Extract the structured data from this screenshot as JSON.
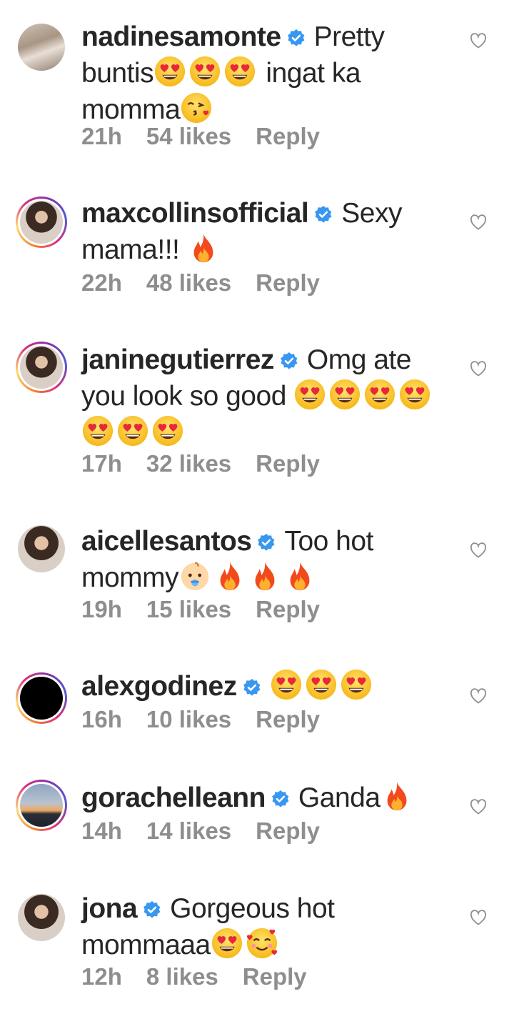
{
  "colors": {
    "username": "#262626",
    "meta": "#8e8e8e",
    "verified": "#3897f0",
    "heart_outline": "#8e8e8e"
  },
  "comments": [
    {
      "username": "nadinesamonte",
      "text1": "Pretty buntis",
      "emojis1": [
        "heart-eyes",
        "heart-eyes",
        "heart-eyes"
      ],
      "text2": " ingat ka momma",
      "emojis2": [
        "kissing-heart"
      ],
      "time": "21h",
      "likes": "54 likes",
      "reply": "Reply",
      "story_ring": false,
      "avatar_icon": "family-photo"
    },
    {
      "username": "maxcollinsofficial",
      "text1": "Sexy mama!!! ",
      "emojis1": [
        "fire"
      ],
      "time": "22h",
      "likes": "48 likes",
      "reply": "Reply",
      "story_ring": true,
      "avatar_icon": "portrait-photo"
    },
    {
      "username": "janinegutierrez",
      "text1": "Omg ate you look so good ",
      "emojis1": [
        "heart-eyes",
        "heart-eyes",
        "heart-eyes",
        "heart-eyes",
        "heart-eyes",
        "heart-eyes",
        "heart-eyes"
      ],
      "time": "17h",
      "likes": "32 likes",
      "reply": "Reply",
      "story_ring": true,
      "avatar_icon": "portrait-photo"
    },
    {
      "username": "aicellesantos",
      "text1": "Too hot mommy",
      "emojis1": [
        "baby",
        "fire",
        "fire",
        "fire"
      ],
      "time": "19h",
      "likes": "15 likes",
      "reply": "Reply",
      "story_ring": false,
      "avatar_icon": "portrait-photo"
    },
    {
      "username": "alexgodinez",
      "text1": "",
      "emojis1": [
        "heart-eyes",
        "heart-eyes",
        "heart-eyes"
      ],
      "time": "16h",
      "likes": "10 likes",
      "reply": "Reply",
      "story_ring": true,
      "avatar_icon": "black-photo"
    },
    {
      "username": "gorachelleann",
      "text1": "Ganda",
      "emojis1": [
        "fire"
      ],
      "time": "14h",
      "likes": "14 likes",
      "reply": "Reply",
      "story_ring": true,
      "avatar_icon": "sunset-photo"
    },
    {
      "username": "jona",
      "text1": "Gorgeous hot mommaaa",
      "emojis1": [
        "heart-eyes",
        "smiling-hearts"
      ],
      "time": "12h",
      "likes": "8 likes",
      "reply": "Reply",
      "story_ring": false,
      "avatar_icon": "portrait-photo"
    }
  ]
}
